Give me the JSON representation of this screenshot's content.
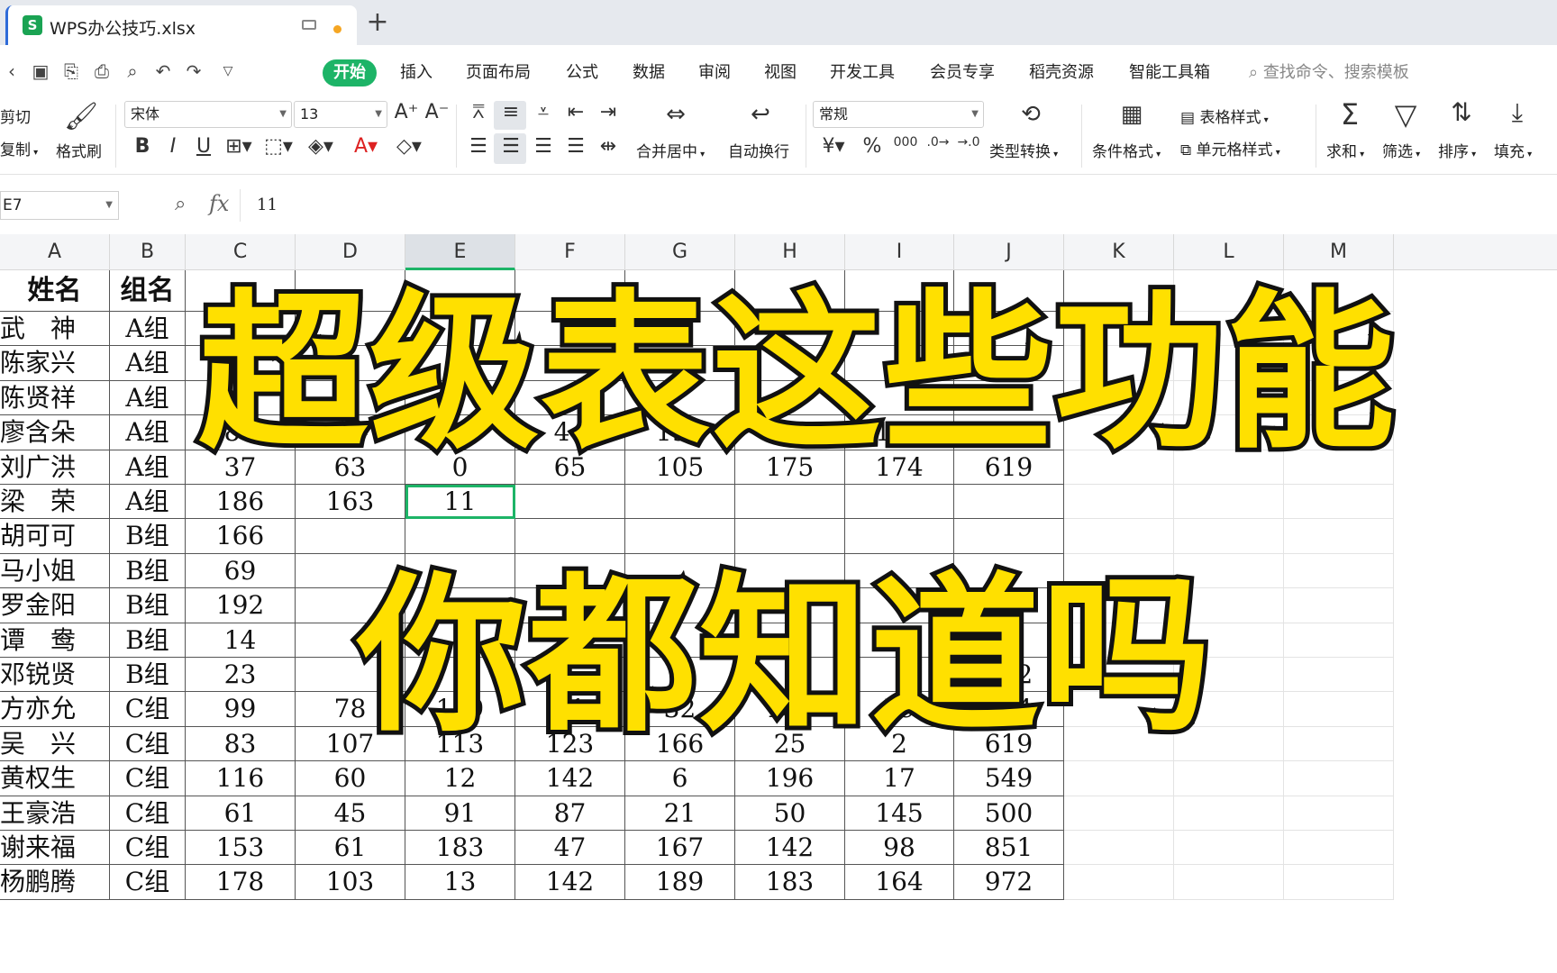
{
  "tab": {
    "title": "WPS办公技巧.xlsx",
    "logo": "S"
  },
  "menu": {
    "items": [
      "开始",
      "插入",
      "页面布局",
      "公式",
      "数据",
      "审阅",
      "视图",
      "开发工具",
      "会员专享",
      "稻壳资源",
      "智能工具箱"
    ],
    "search": "查找命令、搜索模板"
  },
  "ribbon": {
    "cut": "剪切",
    "copy": "复制",
    "format_painter": "格式刷",
    "font_name": "宋体",
    "font_size": "13",
    "merge_center": "合并居中",
    "wrap_text": "自动换行",
    "number_format": "常规",
    "type_convert": "类型转换",
    "conditional_format": "条件格式",
    "table_style": "表格样式",
    "cell_style": "单元格样式",
    "sum": "求和",
    "filter": "筛选",
    "sort": "排序",
    "fill": "填充"
  },
  "formula_bar": {
    "cell_ref": "E7",
    "value": "11"
  },
  "columns": [
    "A",
    "B",
    "C",
    "D",
    "E",
    "F",
    "G",
    "H",
    "I",
    "J",
    "K",
    "L",
    "M"
  ],
  "selected_column": "E",
  "header_row": [
    "姓名",
    "组名"
  ],
  "rows": [
    [
      "武　神",
      "A组",
      "",
      "",
      "",
      "",
      "",
      "",
      "",
      ""
    ],
    [
      "陈家兴",
      "A组",
      "",
      "",
      "",
      "",
      "",
      "",
      "",
      ""
    ],
    [
      "陈贤祥",
      "A组",
      "",
      "",
      "",
      "",
      "",
      "",
      "",
      ""
    ],
    [
      "廖含朵",
      "A组",
      "89",
      "59",
      "100",
      "44",
      "190",
      "41",
      "185",
      "708"
    ],
    [
      "刘广洪",
      "A组",
      "37",
      "63",
      "0",
      "65",
      "105",
      "175",
      "174",
      "619"
    ],
    [
      "梁　荣",
      "A组",
      "186",
      "163",
      "11",
      "",
      "",
      "",
      "",
      ""
    ],
    [
      "胡可可",
      "B组",
      "166",
      "",
      "",
      "",
      "",
      "",
      "",
      ""
    ],
    [
      "马小姐",
      "B组",
      "69",
      "",
      "",
      "",
      "",
      "",
      "",
      ""
    ],
    [
      "罗金阳",
      "B组",
      "192",
      "",
      "",
      "",
      "",
      "",
      "",
      ""
    ],
    [
      "谭　鸯",
      "B组",
      "14",
      "",
      "",
      "",
      "",
      "",
      "",
      ""
    ],
    [
      "邓锐贤",
      "B组",
      "23",
      "",
      "",
      "",
      "",
      "",
      "",
      "492"
    ],
    [
      "方亦允",
      "C组",
      "99",
      "78",
      "139",
      "41",
      "32",
      "186",
      "79",
      "654"
    ],
    [
      "吴　兴",
      "C组",
      "83",
      "107",
      "113",
      "123",
      "166",
      "25",
      "2",
      "619"
    ],
    [
      "黄权生",
      "C组",
      "116",
      "60",
      "12",
      "142",
      "6",
      "196",
      "17",
      "549"
    ],
    [
      "王豪浩",
      "C组",
      "61",
      "45",
      "91",
      "87",
      "21",
      "50",
      "145",
      "500"
    ],
    [
      "谢来福",
      "C组",
      "153",
      "61",
      "183",
      "47",
      "167",
      "142",
      "98",
      "851"
    ],
    [
      "杨鹏腾",
      "C组",
      "178",
      "103",
      "13",
      "142",
      "189",
      "183",
      "164",
      "972"
    ]
  ],
  "headline": {
    "line1": "超级表这些功能",
    "line2": "你都知道吗"
  },
  "colors": {
    "accent": "#1db467",
    "headline_fill": "#ffe000",
    "headline_stroke": "#111111"
  }
}
